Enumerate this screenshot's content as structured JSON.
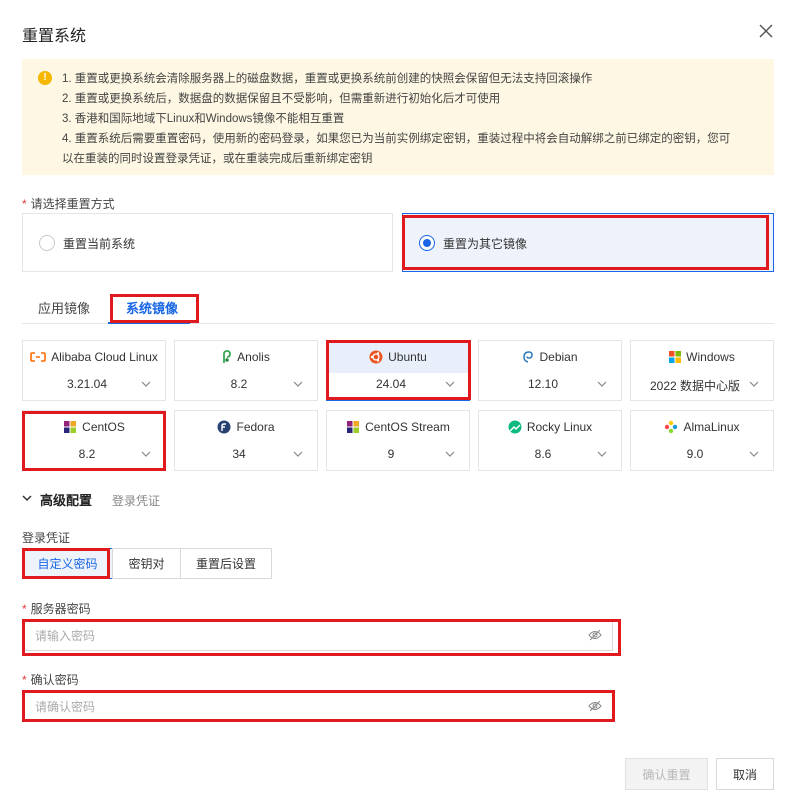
{
  "dialog": {
    "title": "重置系统"
  },
  "notice": {
    "lines": [
      "1. 重置或更换系统会清除服务器上的磁盘数据，重置或更换系统前创建的快照会保留但无法支持回滚操作",
      "2. 重置或更换系统后，数据盘的数据保留且不受影响，但需重新进行初始化后才可使用",
      "3. 香港和国际地域下Linux和Windows镜像不能相互重置",
      "4. 重置系统后需要重置密码，使用新的密码登录，如果您已为当前实例绑定密钥，重装过程中将会自动解绑之前已绑定的密钥，您可",
      "以在重装的同时设置登录凭证，或在重装完成后重新绑定密钥"
    ]
  },
  "reset_mode": {
    "label": "请选择重置方式",
    "options": [
      "重置当前系统",
      "重置为其它镜像"
    ],
    "selected": "重置为其它镜像"
  },
  "image_tabs": {
    "items": [
      "应用镜像",
      "系统镜像"
    ],
    "active": "系统镜像"
  },
  "images": [
    {
      "name": "Alibaba Cloud Linux",
      "version": "3.21.04",
      "icon": "alibaba-cloud-icon",
      "color": "#ff6a00"
    },
    {
      "name": "Anolis",
      "version": "8.2",
      "icon": "anolis-icon",
      "color": "#3aa757"
    },
    {
      "name": "Ubuntu",
      "version": "24.04",
      "icon": "ubuntu-icon",
      "color": "#e95420",
      "selected": true
    },
    {
      "name": "Debian",
      "version": "12.10",
      "icon": "debian-icon",
      "color": "#2b7bbd"
    },
    {
      "name": "Windows",
      "version": "2022 数据中心版",
      "icon": "windows-icon",
      "color": "#00a4ef"
    },
    {
      "name": "CentOS",
      "version": "8.2",
      "icon": "centos-icon",
      "color": "#932279"
    },
    {
      "name": "Fedora",
      "version": "34",
      "icon": "fedora-icon",
      "color": "#294172"
    },
    {
      "name": "CentOS Stream",
      "version": "9",
      "icon": "centos-stream-icon",
      "color": "#932279"
    },
    {
      "name": "Rocky Linux",
      "version": "8.6",
      "icon": "rocky-linux-icon",
      "color": "#10b981"
    },
    {
      "name": "AlmaLinux",
      "version": "9.0",
      "icon": "almalinux-icon",
      "color": "#ffcb05"
    }
  ],
  "advanced": {
    "title": "高级配置",
    "subtitle": "登录凭证"
  },
  "credential": {
    "label": "登录凭证",
    "options": [
      "自定义密码",
      "密钥对",
      "重置后设置"
    ],
    "selected": "自定义密码"
  },
  "server_password": {
    "label": "服务器密码",
    "placeholder": "请输入密码"
  },
  "confirm_password": {
    "label": "确认密码",
    "placeholder": "请确认密码"
  },
  "footer": {
    "confirm_label": "确认重置",
    "cancel_label": "取消"
  }
}
